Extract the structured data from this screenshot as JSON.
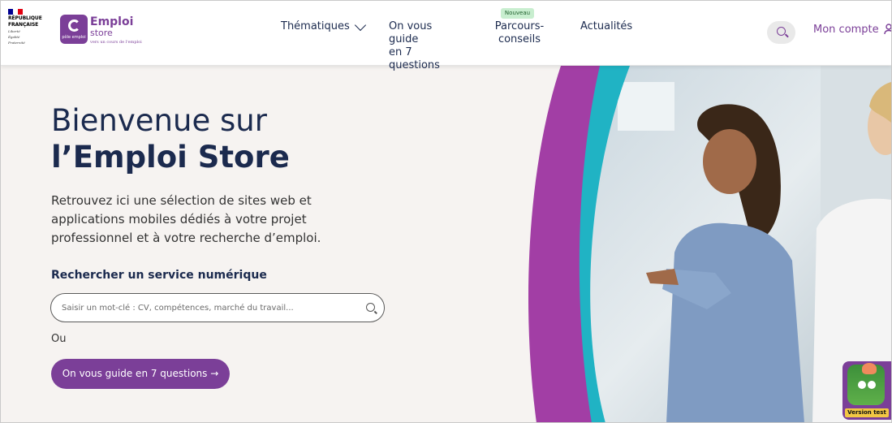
{
  "header": {
    "gov_lines": [
      "RÉPUBLIQUE",
      "FRANÇAISE"
    ],
    "gov_motto": [
      "Liberté",
      "Égalité",
      "Fraternité"
    ],
    "logo_partner": "pôle emploi",
    "brand_line1": "Emploi",
    "brand_line2": "store",
    "brand_tagline": "vers un cours de l'emploi",
    "nav": {
      "thematiques": "Thématiques",
      "guide_line1": "On vous guide",
      "guide_line2": "en 7 questions",
      "parcours_badge": "Nouveau",
      "parcours_line1": "Parcours-",
      "parcours_line2": "conseils",
      "actualites": "Actualités"
    },
    "account_label": "Mon compte"
  },
  "hero": {
    "title_line1": "Bienvenue sur",
    "title_line2": "l’Emploi Store",
    "intro_lines": [
      "Retrouvez ici une sélection de sites web et",
      "applications mobiles dédiés à votre projet",
      "professionnel et à votre recherche d’emploi."
    ],
    "search_title": "Rechercher un service numérique",
    "search_placeholder": "Saisir un mot-clé : CV, compétences, marché du travail...",
    "or_label": "Ou",
    "guide_button": "On vous guide en 7 questions →"
  },
  "version_badge": "Version test",
  "colors": {
    "brand_purple": "#7b3f98",
    "navy_text": "#1b2a4e",
    "curve_teal": "#20b3c4",
    "curve_magenta": "#a23ea5",
    "hero_bg": "#f6f3f1"
  }
}
